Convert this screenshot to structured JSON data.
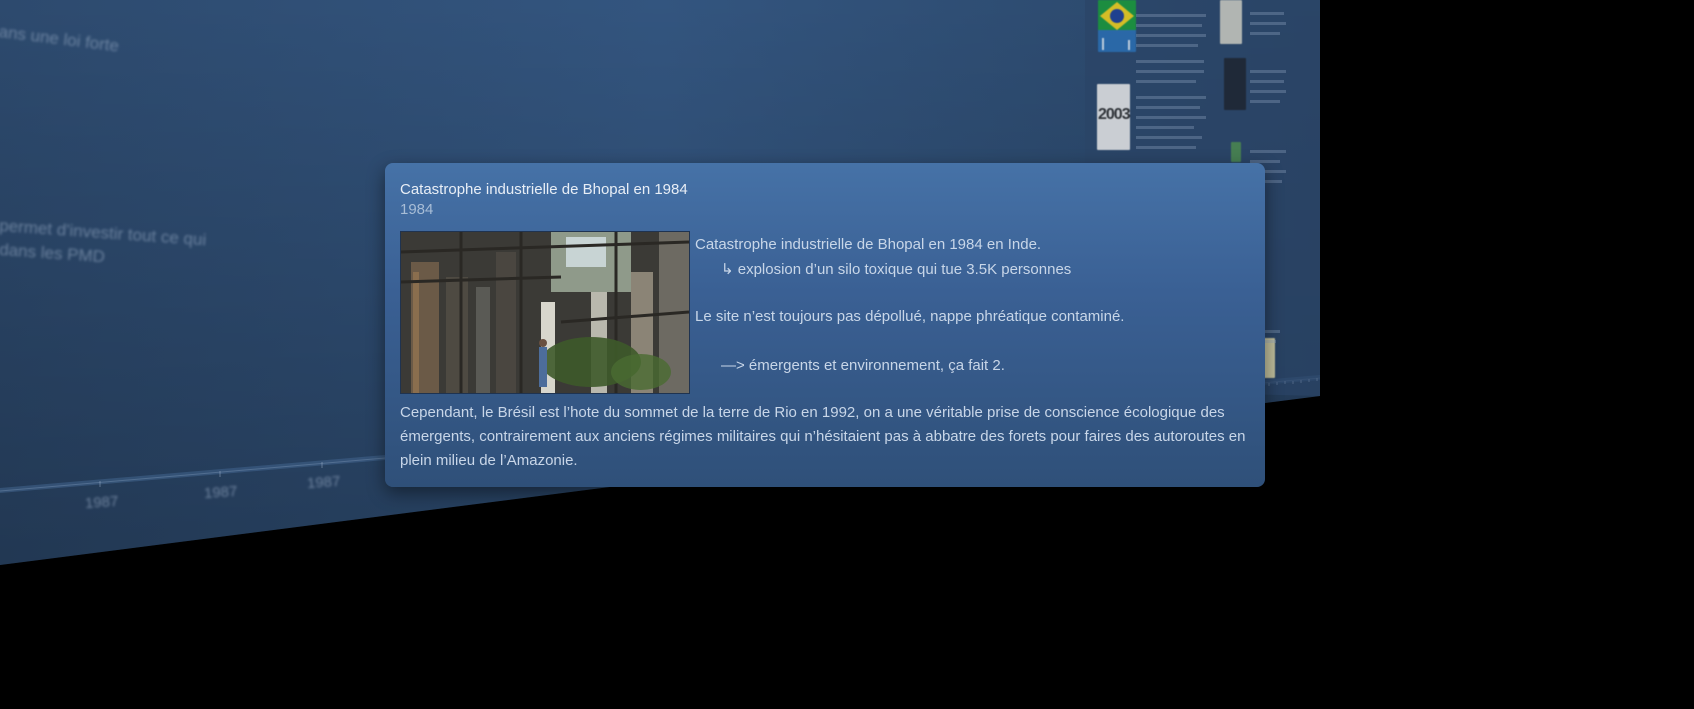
{
  "background": {
    "blurred_texts": [
      "ans une loi forte",
      "permet d'investir tout ce qui",
      "dans les PMD"
    ],
    "years": [
      "1987",
      "1987",
      "1987"
    ],
    "thumb_year": "2003"
  },
  "popup": {
    "title": "Catastrophe industrielle de Bhopal en 1984",
    "date": "1984",
    "image_icon": "factory-ruins-photo",
    "lines": [
      "Catastrophe industrielle de Bhopal en 1984 en Inde.",
      "↳ explosion d’un silo toxique qui tue 3.5K personnes",
      "Le site n’est toujours pas dépollué, nappe phréatique contaminé.",
      "—> émergents et environnement, ça fait 2."
    ],
    "footer": "Cependant, le Brésil est l’hote du sommet de la terre de Rio en 1992, on a une véritable prise de conscience écologique des émergents, contrairement aux anciens régimes militaires qui n’hésitaient pas à abbatre des forets pour faires des autoroutes en plein milieu de l’Amazonie."
  },
  "colors": {
    "panel": "#2f4d72",
    "popup": "#3f6699",
    "background": "#000000"
  }
}
